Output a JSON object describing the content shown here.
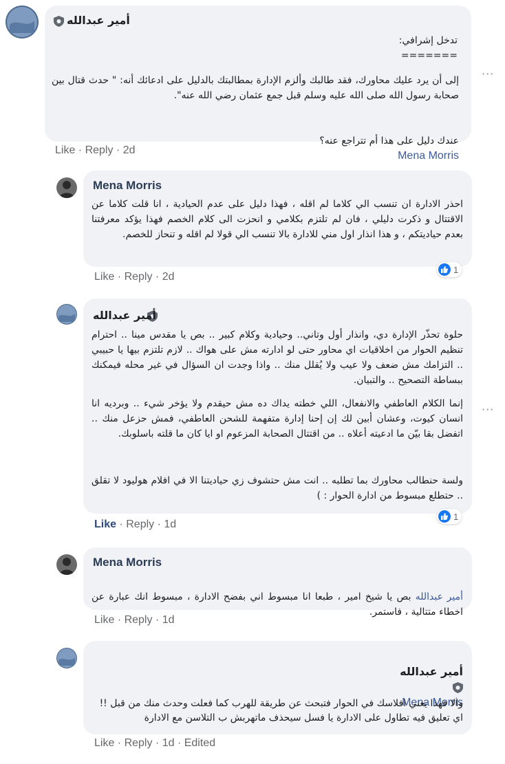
{
  "colors": {
    "bubble": "#f0f2f5",
    "link": "#385898",
    "like_blue": "#1877f2"
  },
  "comments": [
    {
      "author": "أمير عبدالله",
      "paragraphs": [
        "تدخل إشرافي:\n=======",
        "إلى أن يرد عليك محاورك، فقد طالبك وألزم الإدارة بمطالبتك بالدليل على ادعائك أنه: \" حدث قتال بين صحابة رسول الله صلى الله عليه وسلم قبل جمع عثمان رضي الله عنه\"."
      ],
      "tag_prefix": "عندك دليل على هذا أم تتراجع عنه؟",
      "tag_name": "Mena Morris",
      "like": "Like",
      "reply": "Reply",
      "time": "2d"
    },
    {
      "author": "Mena Morris",
      "text": "احذر الادارة ان تنسب الي كلاما لم اقله ، فهذا دليل على عدم الحيادية ، انا قلت كلاما عن الاقتتال و ذكرت دليلي ، فان لم تلتزم بكلامي و انحزت الى كلام الخصم فهذا يؤكد معرفتنا بعدم حياديتكم ، و هذا انذار اول مني للادارة بالا تنسب الي قولا لم اقله و تنحاز للخصم.",
      "like": "Like",
      "reply": "Reply",
      "time": "2d",
      "reactions": "1"
    },
    {
      "author": "أمير عبدالله",
      "paragraphs": [
        "حلوة تحذّر الإدارة دي، وانذار أول وتاني.. وحيادية وكلام كبير .. بص يا مقدس مينا .. احترام تنظيم الحوار من اخلاقيات اي محاور حتى لو ادارته مش على هواك .. لازم تلتزم بيها يا حبيبي .. التزامك مش ضعف ولا عيب ولا يُقلل منك .. واذا وجدت ان السؤال في غير محله فيمكنك ببساطة التصحيح .. والتبيان.",
        "إنما الكلام العاطفي والانفعال، اللي خطته يداك ده مش حيقدم ولا يؤخر شيء .. وبرديه انا انسان كيوت، وعشان أبين لك إن إحنا إدارة متفهمة للشحن العاطفي، فمش حزعل منك .. اتفضل بقا بيّن ما ادعيته أعلاه .. من اقتتال الصحابة المزعوم او ايا كان ما قلته باسلوبك.",
        "ولسة حنطالب محاورك بما تطلبه .. انت مش حتشوف زي حياديتنا الا في افلام هوليود لا تقلق .. حتطلع مبسوط من ادارة الحوار : )"
      ],
      "like": "Like",
      "reply": "Reply",
      "time": "1d",
      "reactions": "1"
    },
    {
      "author": "Mena Morris",
      "tag_name": "أمير عبدالله",
      "text": " بص يا شيخ امير ، طبعا انا مبسوط اني بفضح الادارة ، مبسوط انك عبارة عن اخطاء متتالية ، فاستمر.",
      "like": "Like",
      "reply": "Reply",
      "time": "1d"
    },
    {
      "author": "أمير عبدالله",
      "tag_name": "Mena Morris",
      "paragraphs": [
        "اي تعليق فيه تطاول على الادارة يا فسل سيحذف ماتهربش ب التلاسن مع الادارة",
        "والا فهذا يعني افلاسك في الحوار فتبحث عن طريقة للهرب كما فعلت وحدث منك من قبل !!"
      ],
      "like": "Like",
      "reply": "Reply",
      "time": "1d",
      "edited": "Edited"
    }
  ],
  "dots_label": "···"
}
